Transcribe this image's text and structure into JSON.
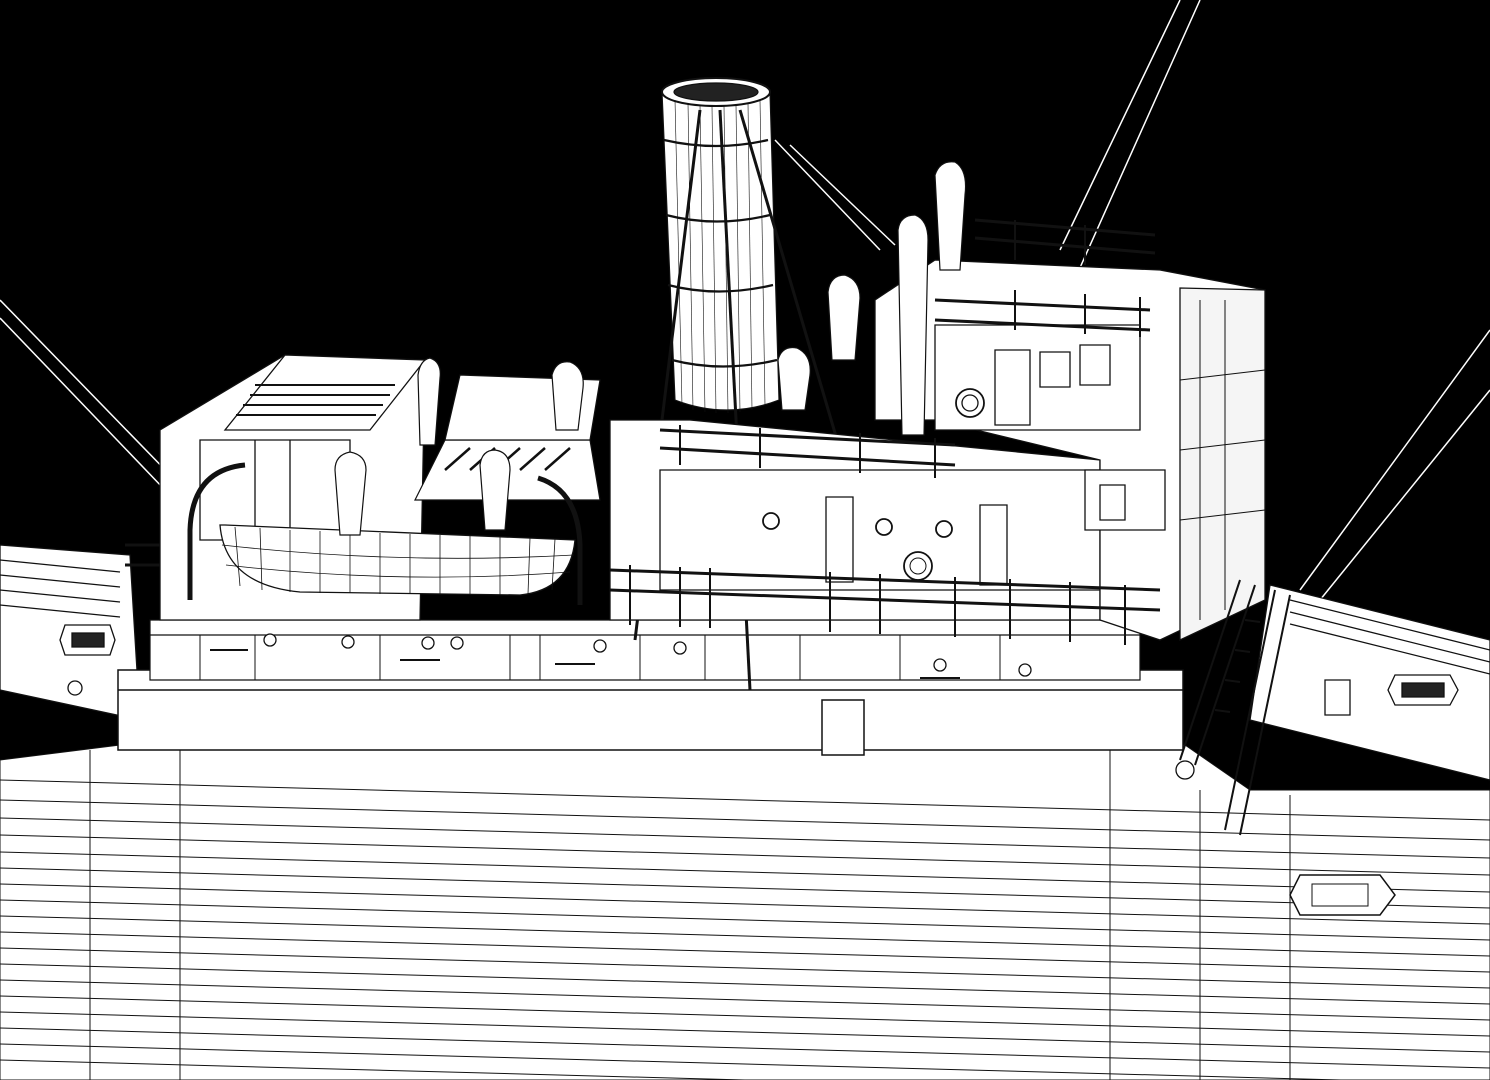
{
  "scene": {
    "subject": "ship-superstructure-wireframe-render",
    "colors": {
      "background": "#000000",
      "surface": "#ffffff",
      "wire": "#111111",
      "shade": "#e6e6e6"
    }
  }
}
